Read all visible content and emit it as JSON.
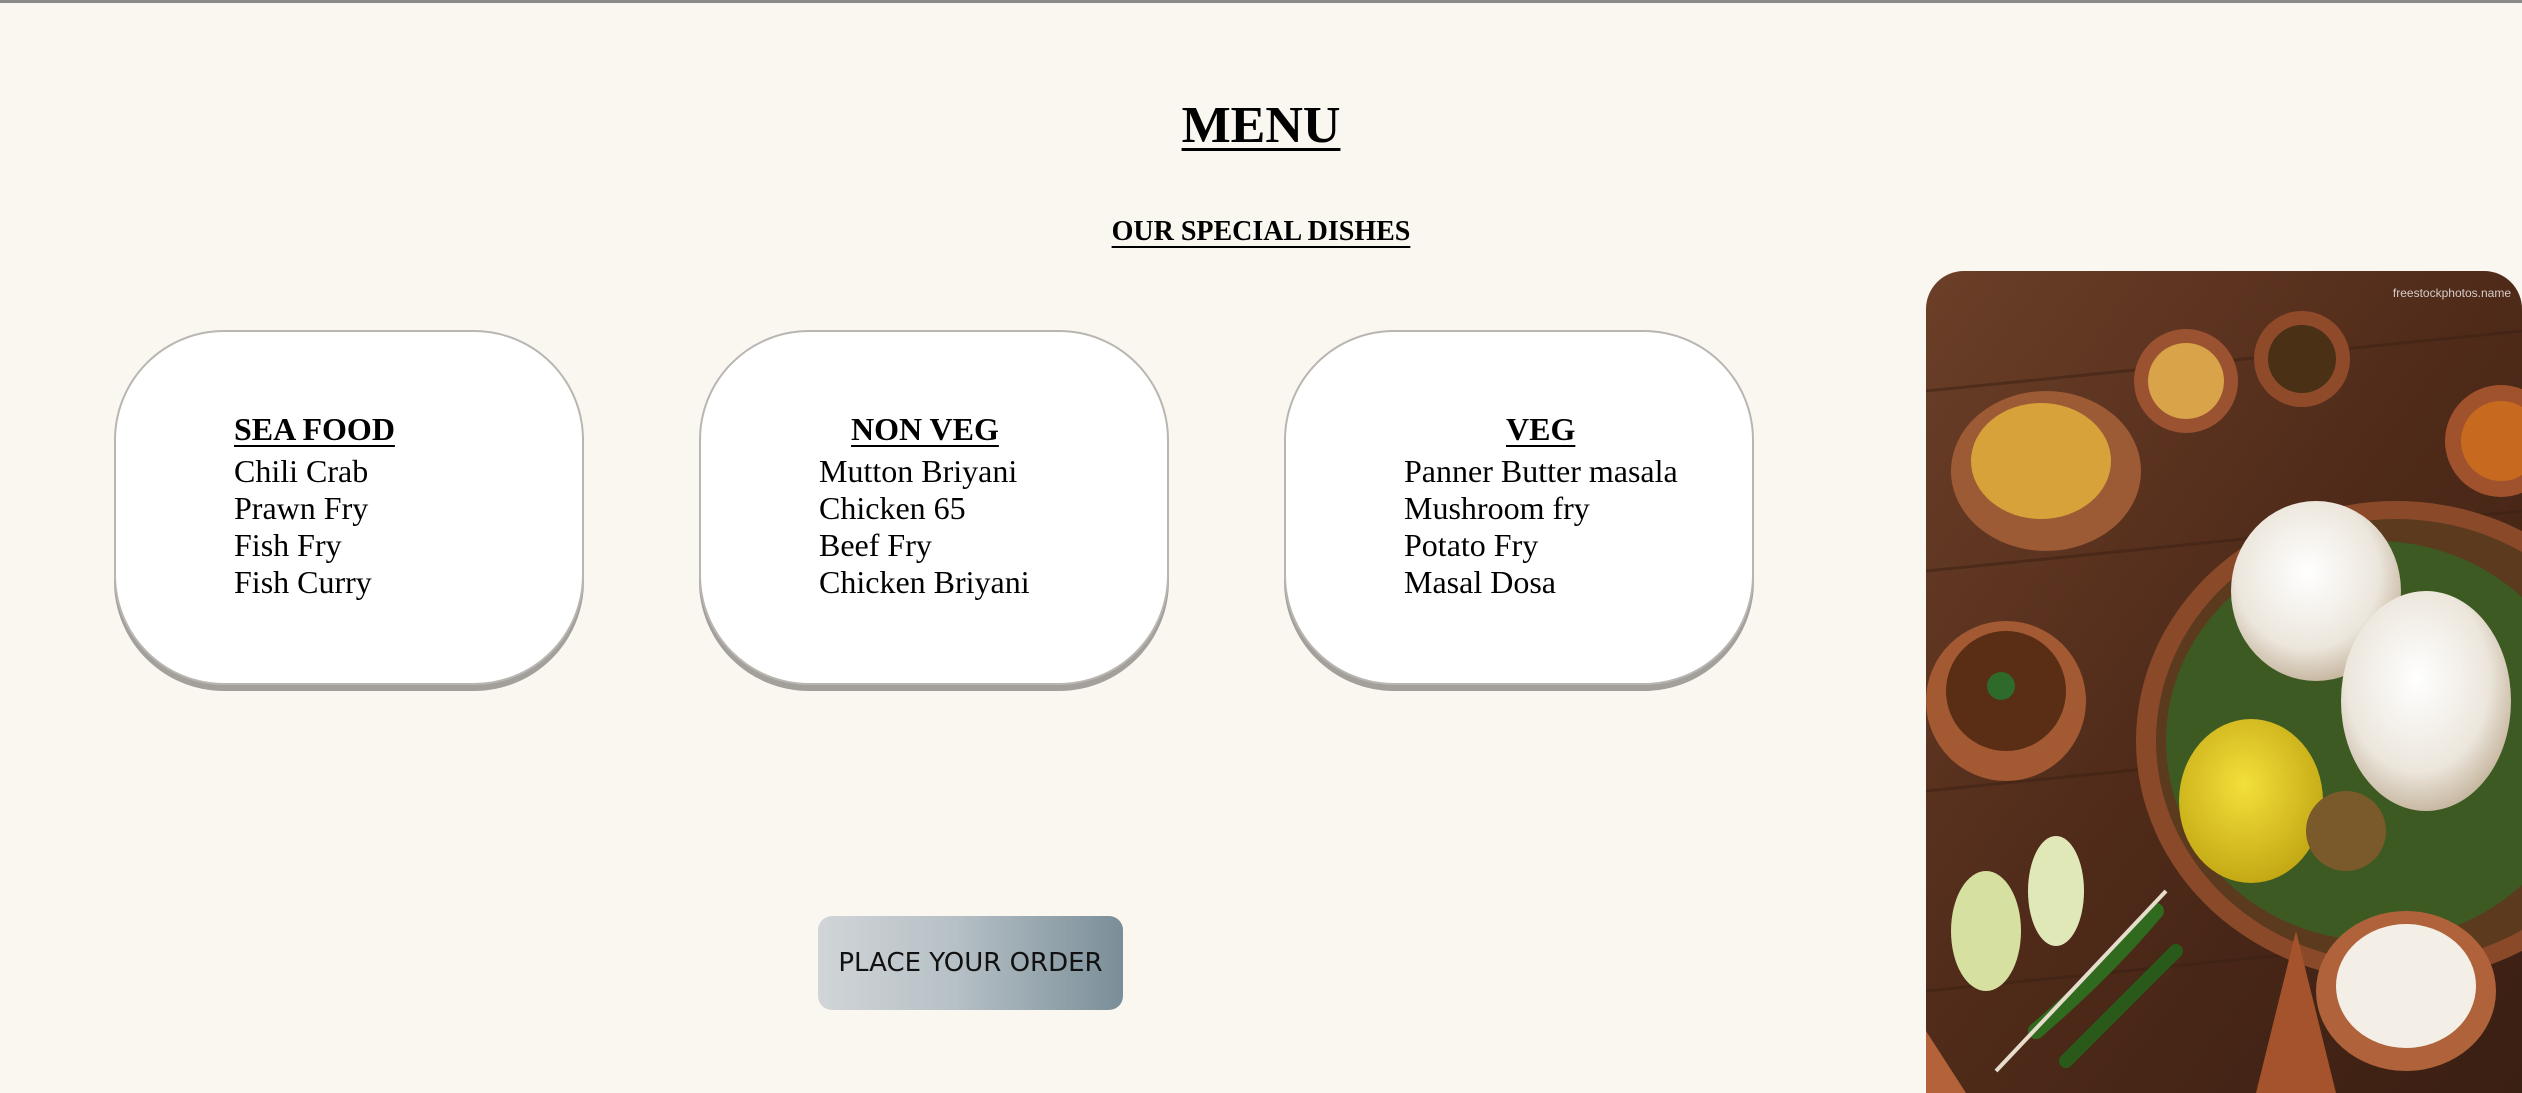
{
  "header": {
    "title": "MENU",
    "subtitle": "OUR SPECIAL DISHES"
  },
  "categories": [
    {
      "title": "SEA FOOD",
      "items": [
        "Chili Crab",
        "Prawn Fry",
        "Fish Fry",
        "Fish Curry"
      ]
    },
    {
      "title": "NON VEG",
      "items": [
        "Mutton Briyani",
        "Chicken 65",
        "Beef Fry",
        "Chicken Briyani"
      ]
    },
    {
      "title": "VEG",
      "items": [
        "Panner Butter masala",
        "Mushroom fry",
        "Potato Fry",
        "Masal Dosa"
      ]
    }
  ],
  "order_button": {
    "label": "PLACE YOUR ORDER"
  },
  "photo": {
    "watermark": "freestockphotos.name"
  },
  "colors": {
    "background": "#faf7f1",
    "card": "#ffffff",
    "card_border": "#b9b6b1",
    "button_start": "#d1d5d8",
    "button_end": "#7a8e98"
  }
}
